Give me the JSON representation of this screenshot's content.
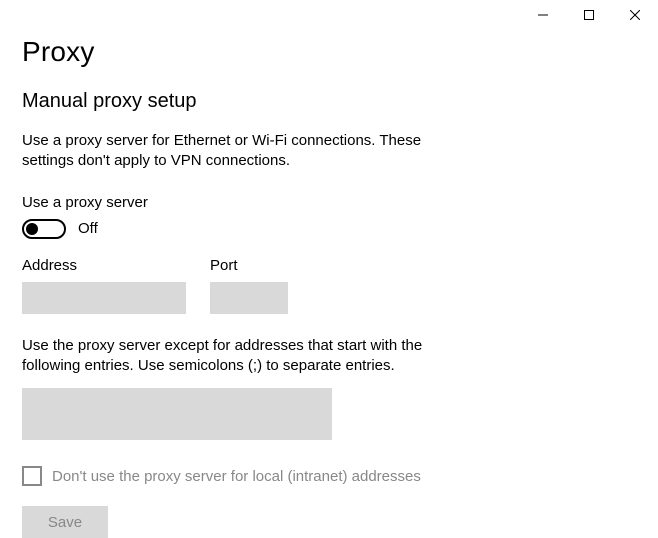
{
  "page_title": "Proxy",
  "section_title": "Manual proxy setup",
  "description": "Use a proxy server for Ethernet or Wi-Fi connections. These settings don't apply to VPN connections.",
  "use_proxy": {
    "label": "Use a proxy server",
    "status": "Off",
    "value": false
  },
  "address": {
    "label": "Address",
    "value": ""
  },
  "port": {
    "label": "Port",
    "value": ""
  },
  "exceptions": {
    "description": "Use the proxy server except for addresses that start with the following entries. Use semicolons (;) to separate entries.",
    "value": ""
  },
  "bypass_local": {
    "label": "Don't use the proxy server for local (intranet) addresses",
    "checked": false
  },
  "save_label": "Save"
}
